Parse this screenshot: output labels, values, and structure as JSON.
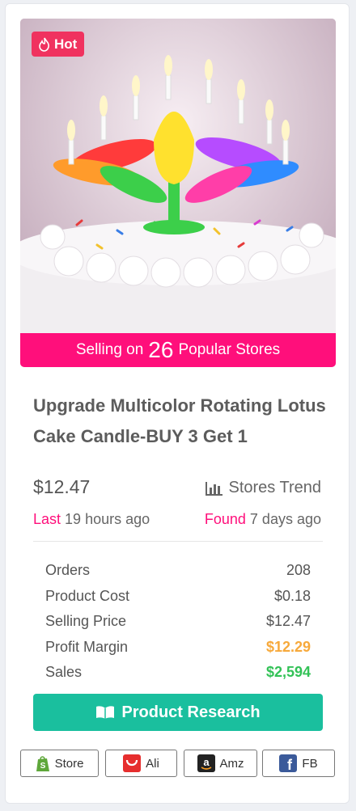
{
  "badge": {
    "label": "Hot"
  },
  "image": {
    "alt_subject": "rotating lotus cake candle"
  },
  "selling": {
    "prefix": "Selling on",
    "count": "26",
    "suffix": "Popular Stores"
  },
  "product": {
    "title": "Upgrade Multicolor Rotating Lotus Cake Candle-BUY 3 Get 1",
    "price": "$12.47",
    "trend_label": "Stores Trend",
    "last_label": "Last",
    "last_value": "19 hours ago",
    "found_label": "Found",
    "found_value": "7 days ago"
  },
  "stats": [
    {
      "label": "Orders",
      "value": "208",
      "color": "#555555"
    },
    {
      "label": "Product Cost",
      "value": "$0.18",
      "color": "#555555"
    },
    {
      "label": "Selling Price",
      "value": "$12.47",
      "color": "#555555"
    },
    {
      "label": "Profit Margin",
      "value": "$12.29",
      "color": "#f7a93b"
    },
    {
      "label": "Sales",
      "value": "$2,594",
      "color": "#33c257"
    }
  ],
  "research_button": {
    "label": "Product Research",
    "color": "#1abf9e"
  },
  "links": [
    {
      "label": "Store",
      "icon": "shopify-icon"
    },
    {
      "label": "Ali",
      "icon": "aliexpress-icon"
    },
    {
      "label": "Amz",
      "icon": "amazon-icon"
    },
    {
      "label": "FB",
      "icon": "facebook-icon"
    }
  ],
  "colors": {
    "accent_pink": "#ff0f7b",
    "hot_red": "#f0325f",
    "teal": "#1abf9e"
  }
}
